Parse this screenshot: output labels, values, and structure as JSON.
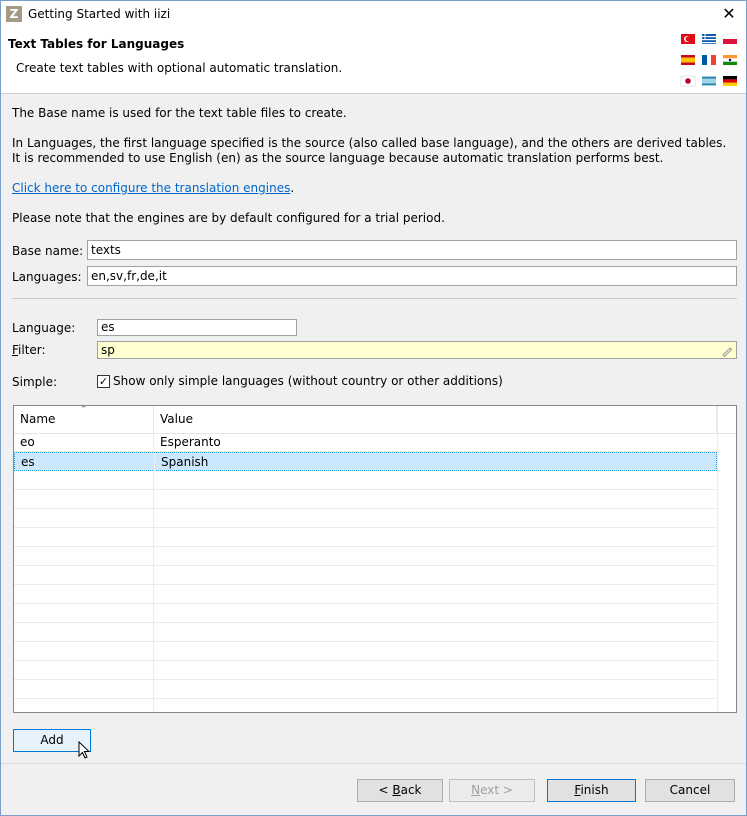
{
  "window": {
    "title": "Getting Started with iizi",
    "app_icon_letter": "Z",
    "close_symbol": "✕"
  },
  "header": {
    "title": "Text Tables for Languages",
    "description": "Create text tables with optional automatic translation."
  },
  "intro": {
    "line1": "The Base name is used for the text table files to create.",
    "line2": "In Languages, the first language specified is the source (also called base language), and the others are derived tables. It is recommended to use English (en) as the source language because automatic translation performs best.",
    "link": "Click here to configure the translation engines",
    "link_suffix": ".",
    "note": "Please note that the engines are by default configured for a trial period."
  },
  "form": {
    "base_name_label": "Base name:",
    "base_name_value": "texts",
    "languages_label": "Languages:",
    "languages_value": "en,sv,fr,de,it",
    "language_label": "Language:",
    "language_value": "es",
    "filter_label_first": "F",
    "filter_label_rest": "ilter:",
    "filter_value": "sp",
    "simple_label": "Simple:",
    "simple_checkbox_label": "Show only simple languages (without country or other additions)",
    "simple_checked": true
  },
  "table": {
    "columns": [
      "Name",
      "Value"
    ],
    "rows": [
      {
        "name": "eo",
        "value": "Esperanto",
        "selected": false
      },
      {
        "name": "es",
        "value": "Spanish",
        "selected": true
      }
    ]
  },
  "buttons": {
    "add": "Add",
    "back_mnemonic": "B",
    "back_prefix": "< ",
    "back_rest": "ack",
    "next_mnemonic": "N",
    "next_rest": "ext >",
    "finish_mnemonic": "F",
    "finish_rest": "inish",
    "cancel": "Cancel"
  },
  "flags": [
    "turkey",
    "greece",
    "poland",
    "spain",
    "france",
    "india",
    "japan",
    "israel",
    "germany"
  ],
  "colors": {
    "accent": "#0078d7",
    "link": "#0066cc",
    "selection": "#cce8ff",
    "filter_bg": "#ffffd0"
  }
}
